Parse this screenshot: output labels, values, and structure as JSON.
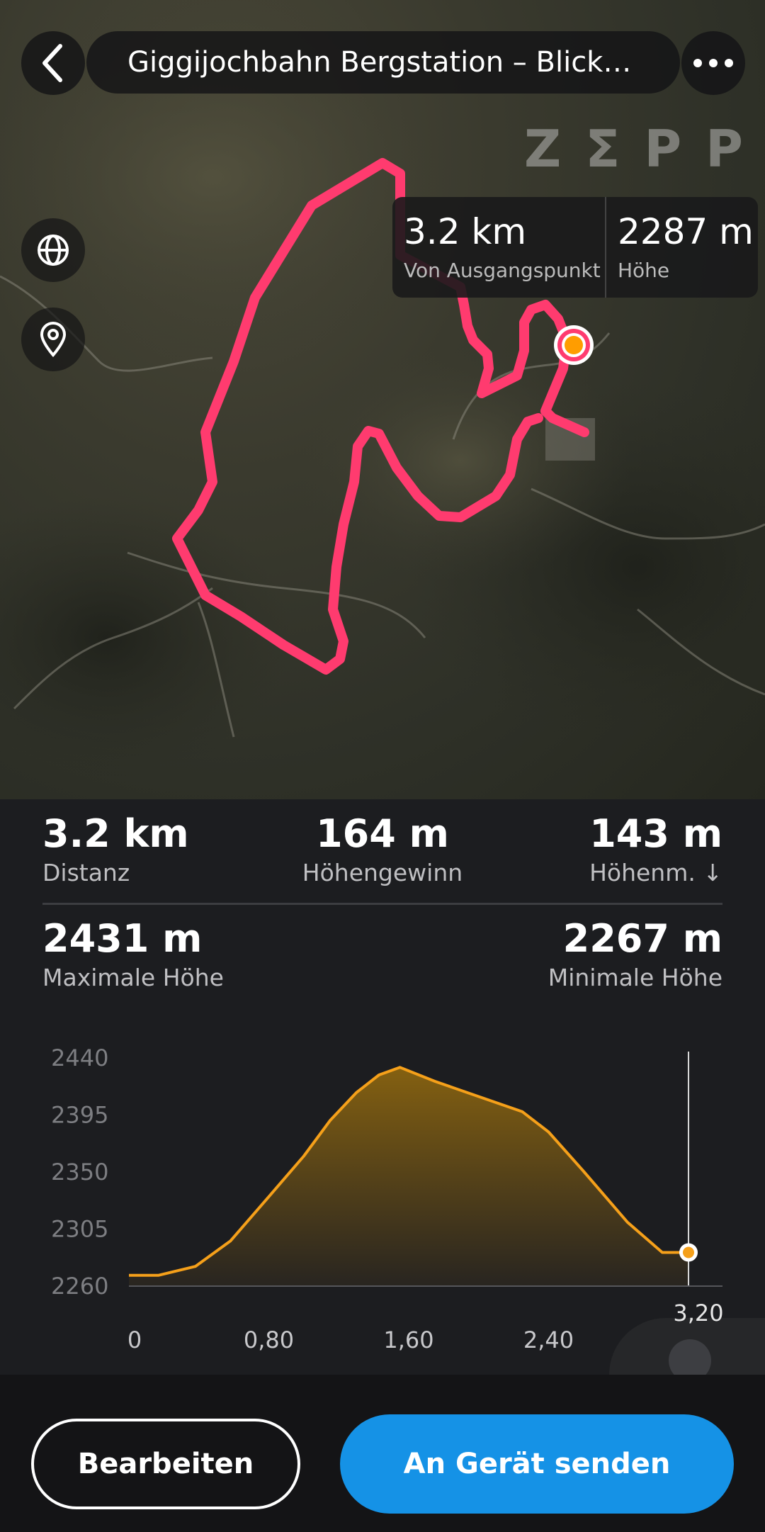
{
  "header": {
    "title": "Giggijochbahn Bergstation – Blick üb...",
    "back_icon": "chevron-left-icon",
    "more_icon": "more-dots-icon"
  },
  "map": {
    "logo": "ZΣPP",
    "controls": [
      "globe-icon",
      "location-pin-icon"
    ],
    "route_color": "#ff3b6f",
    "marker_color": "#ff9d00",
    "tooltip": {
      "distance_value": "3.2 km",
      "distance_label": "Von Ausgangspunkt",
      "altitude_value": "2287 m",
      "altitude_label": "Höhe"
    }
  },
  "stats": {
    "distance": {
      "value": "3.2 km",
      "label": "Distanz"
    },
    "ascent": {
      "value": "164 m",
      "label": "Höhengewinn"
    },
    "descent": {
      "value": "143 m",
      "label": "Höhenm. ↓"
    },
    "max_alt": {
      "value": "2431 m",
      "label": "Maximale Höhe"
    },
    "min_alt": {
      "value": "2267 m",
      "label": "Minimale Höhe"
    }
  },
  "chart_data": {
    "type": "area",
    "x": [
      0,
      0.17,
      0.38,
      0.58,
      0.8,
      1.0,
      1.15,
      1.3,
      1.43,
      1.55,
      1.75,
      2.0,
      2.25,
      2.4,
      2.6,
      2.85,
      3.05,
      3.2
    ],
    "y": [
      2268,
      2268,
      2275,
      2295,
      2330,
      2362,
      2390,
      2412,
      2426,
      2432,
      2421,
      2409,
      2397,
      2381,
      2350,
      2310,
      2286,
      2286
    ],
    "xlabel": "",
    "ylabel": "",
    "x_ticks": [
      "0",
      "0,80",
      "1,60",
      "2,40"
    ],
    "y_ticks": [
      "2440",
      "2395",
      "2350",
      "2305",
      "2260"
    ],
    "xlim": [
      0,
      3.2
    ],
    "ylim": [
      2260,
      2440
    ],
    "cursor_label": "3,20",
    "line_color": "#f5a01a"
  },
  "actions": {
    "edit": "Bearbeiten",
    "send": "An Gerät senden"
  }
}
